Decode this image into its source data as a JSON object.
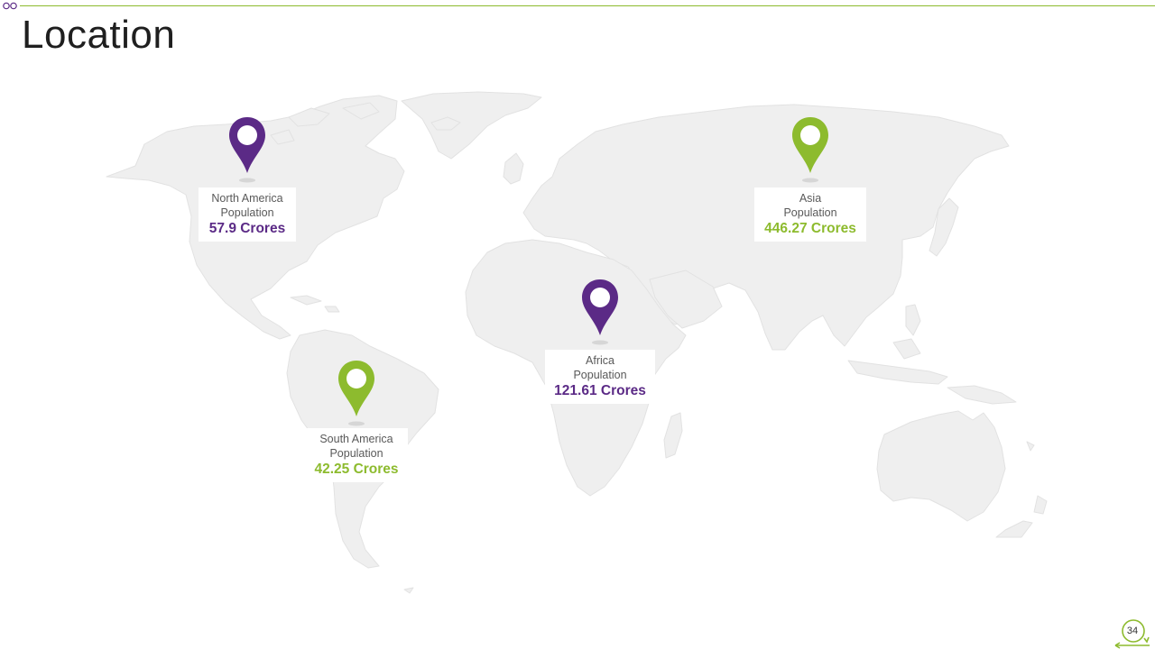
{
  "slide": {
    "title": "Location",
    "page_number": "34"
  },
  "colors": {
    "purple": "#5b2a86",
    "green": "#8dbb2e",
    "map_fill": "#efefef",
    "map_stroke": "#e2e2e2"
  },
  "markers": [
    {
      "id": "north-america",
      "region": "North America",
      "label": "Population",
      "value": "57.9 Crores",
      "color": "purple"
    },
    {
      "id": "asia",
      "region": "Asia",
      "label": "Population",
      "value": "446.27 Crores",
      "color": "green"
    },
    {
      "id": "africa",
      "region": "Africa",
      "label": "Population",
      "value": "121.61 Crores",
      "color": "purple"
    },
    {
      "id": "south-america",
      "region": "South America",
      "label": "Population",
      "value": "42.25 Crores",
      "color": "green"
    }
  ],
  "icons": {
    "pin": "map-pin-icon",
    "slide_badge": "circular-arrow-icon",
    "header_decoration": "double-circle-icon"
  }
}
